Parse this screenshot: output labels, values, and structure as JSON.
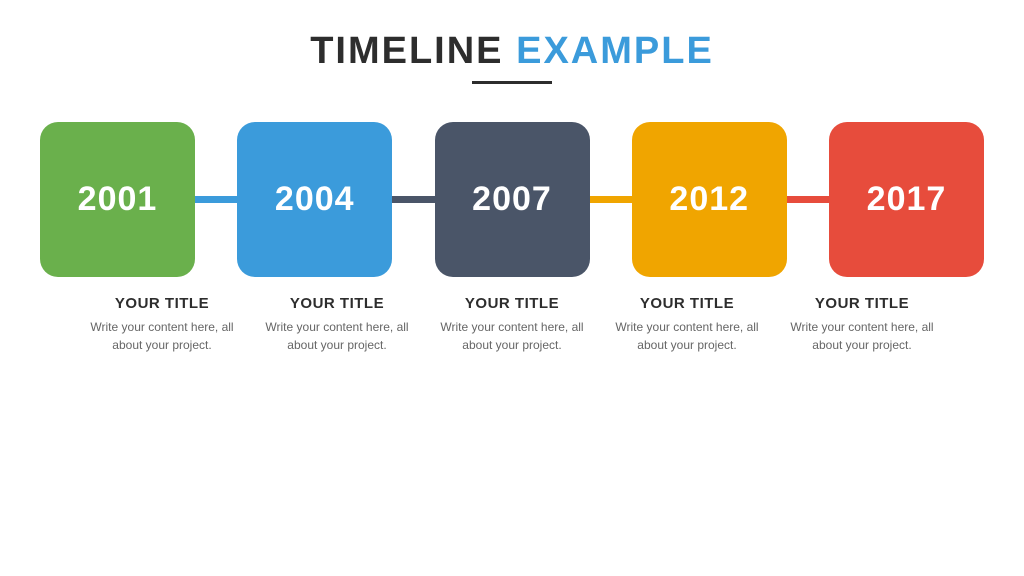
{
  "header": {
    "title_part1": "TIMELINE",
    "title_part2": "EXAMPLE",
    "underline": true
  },
  "timeline": {
    "items": [
      {
        "year": "2001",
        "color_class": "box-green",
        "connector_class": "connector-green",
        "title": "YOUR TITLE",
        "description": "Write your content here, all about your project."
      },
      {
        "year": "2004",
        "color_class": "box-blue",
        "connector_class": "connector-blue",
        "title": "YOUR TITLE",
        "description": "Write your content here, all about your project."
      },
      {
        "year": "2007",
        "color_class": "box-dark",
        "connector_class": "connector-dark",
        "title": "YOUR TITLE",
        "description": "Write your content here, all about your project."
      },
      {
        "year": "2012",
        "color_class": "box-orange",
        "connector_class": "connector-orange",
        "title": "YOUR TITLE",
        "description": "Write your content here, all about your project."
      },
      {
        "year": "2017",
        "color_class": "box-red",
        "connector_class": "connector-red",
        "title": "YOUR TITLE",
        "description": "Write your content here, all about your project."
      }
    ]
  }
}
